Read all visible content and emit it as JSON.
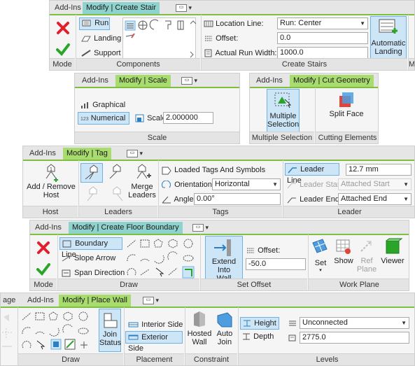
{
  "stair": {
    "tabs": [
      "Add-Ins",
      "Modify | Create Stair"
    ],
    "mode_label": "Mode",
    "components": {
      "run": "Run",
      "landing": "Landing",
      "support": "Support",
      "label": "Components"
    },
    "location_line_label": "Location Line:",
    "location_line_value": "Run: Center",
    "offset_label": "Offset:",
    "offset_value": "0.0",
    "actual_run_width_label": "Actual Run Width:",
    "actual_run_width_value": "1000.0",
    "create_stairs_label": "Create Stairs",
    "automatic_landing": "Automatic\nLanding",
    "edge_char": "M"
  },
  "scale": {
    "tabs": [
      "Add-Ins",
      "Modify | Scale"
    ],
    "graphical": "Graphical",
    "numerical": "Numerical",
    "scale_label": "Scale",
    "scale_value": "2.000000",
    "footer": "Scale"
  },
  "cut": {
    "tabs": [
      "Add-Ins",
      "Modify | Cut Geometry"
    ],
    "multiple_selection": "Multiple\nSelection",
    "split_face": "Split Face",
    "footer_left": "Multiple Selection",
    "footer_right": "Cutting Elements"
  },
  "tag": {
    "tabs": [
      "Add-Ins",
      "Modify | Tag"
    ],
    "add_remove_host": "Add / Remove\nHost",
    "host_label": "Host",
    "merge_leaders": "Merge\nLeaders",
    "leaders_label": "Leaders",
    "loaded_tags": "Loaded Tags And Symbols",
    "orientation_label": "Orientation",
    "orientation_value": "Horizontal",
    "angle_label": "Angle",
    "angle_value": "0.00°",
    "tags_label": "Tags",
    "leader_line": "Leader Line",
    "leader_line_value": "12.7 mm",
    "leader_start": "Leader Start",
    "leader_start_value": "Attached Start",
    "leader_end": "Leader End",
    "leader_end_value": "Attached End",
    "leader_label": "Leader"
  },
  "floor": {
    "tabs": [
      "Add-Ins",
      "Modify | Create Floor Boundary"
    ],
    "boundary_line": "Boundary Line",
    "slope_arrow": "Slope Arrow",
    "span_direction": "Span Direction",
    "mode_label": "Mode",
    "draw_label": "Draw",
    "extend_into_wall": "Extend Into\nWall",
    "offset_label": "Offset:",
    "offset_value": "-50.0",
    "set_offset_label": "Set Offset",
    "set": "Set",
    "show": "Show",
    "ref_plane": "Ref\nPlane",
    "viewer": "Viewer",
    "work_plane_label": "Work Plane"
  },
  "wall": {
    "tabs": [
      "age",
      "Add-Ins",
      "Modify | Place Wall"
    ],
    "join_status": "Join\nStatus",
    "draw_label": "Draw",
    "interior_side": "Interior Side",
    "exterior_side": "Exterior Side",
    "placement_label": "Placement",
    "hosted_wall": "Hosted\nWall",
    "auto_join": "Auto\nJoin",
    "constraint_label": "Constraint",
    "height": "Height",
    "depth": "Depth",
    "level_value": "Unconnected",
    "height_value": "2775.0",
    "levels_label": "Levels"
  },
  "colors": {
    "active_tab": "#a9dc6f",
    "teal_tab": "#8fd3cf",
    "selection": "#cde6f7",
    "selection_border": "#6fb1e4",
    "cancel_red": "#e0202a",
    "finish_green": "#2aa52a"
  }
}
